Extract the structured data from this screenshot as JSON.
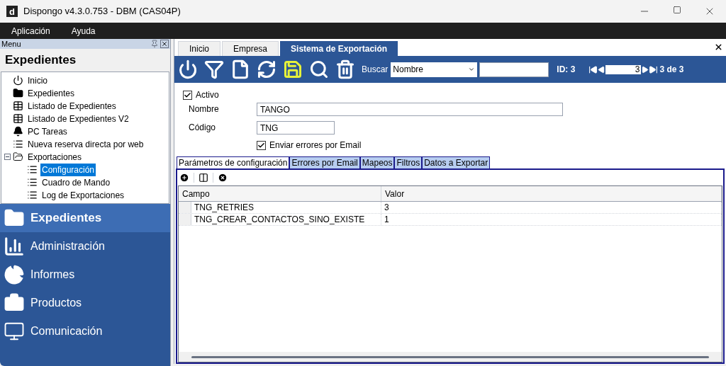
{
  "window": {
    "logo": "d",
    "title": "Dispongo v4.3.0.753 - DBM (CAS04P)"
  },
  "menu_bar": [
    "Aplicación",
    "Ayuda"
  ],
  "side_panel": {
    "header": "Menu",
    "title": "Expedientes",
    "tree": [
      {
        "label": "Inicio",
        "kind": "power",
        "selected": false
      },
      {
        "label": "Expedientes",
        "kind": "folder",
        "selected": false
      },
      {
        "label": "Listado de Expedientes",
        "kind": "table",
        "selected": false
      },
      {
        "label": "Listado de Expedientes V2",
        "kind": "table",
        "selected": false
      },
      {
        "label": "PC Tareas",
        "kind": "bell",
        "selected": false
      },
      {
        "label": "Nueva reserva directa por web",
        "kind": "list",
        "selected": false
      },
      {
        "label": "Exportaciones",
        "kind": "folder-open",
        "selected": false,
        "expanded": true,
        "children": [
          {
            "label": "Configuración",
            "kind": "list",
            "selected": true
          },
          {
            "label": "Cuadro de Mando",
            "kind": "list",
            "selected": false
          },
          {
            "label": "Log de Exportaciones",
            "kind": "list",
            "selected": false
          }
        ]
      }
    ],
    "nav": [
      {
        "label": "Expedientes",
        "kind": "folder",
        "selected": true
      },
      {
        "label": "Administración",
        "kind": "chart",
        "selected": false
      },
      {
        "label": "Informes",
        "kind": "pie",
        "selected": false
      },
      {
        "label": "Productos",
        "kind": "briefcase",
        "selected": false
      },
      {
        "label": "Comunicación",
        "kind": "monitor",
        "selected": false
      }
    ]
  },
  "doc_tabs": [
    {
      "label": "Inicio",
      "selected": false
    },
    {
      "label": "Empresa",
      "selected": false
    },
    {
      "label": "Sistema de Exportación",
      "selected": true
    }
  ],
  "toolbar": {
    "search_label": "Buscar",
    "search_field": "Nombre",
    "id": "ID: 3",
    "record": "3",
    "record_count": "3 de 3"
  },
  "form": {
    "active": {
      "label": "Activo",
      "checked": true
    },
    "fields": [
      {
        "label": "Nombre",
        "value": "TANGO"
      },
      {
        "label": "Código",
        "value": "TNG"
      }
    ],
    "send_errors": {
      "label": "Enviar errores por Email",
      "checked": true
    }
  },
  "sub_tabs": [
    {
      "label": "Parámetros de configuración",
      "selected": true
    },
    {
      "label": "Errores por Email",
      "selected": false
    },
    {
      "label": "Mapeos",
      "selected": false
    },
    {
      "label": "Filtros",
      "selected": false
    },
    {
      "label": "Datos a Exportar",
      "selected": false
    }
  ],
  "table": {
    "columns": [
      "Campo",
      "Valor"
    ],
    "rows": [
      [
        "TNG_RETRIES",
        "3"
      ],
      [
        "TNG_CREAR_CONTACTOS_SINO_EXISTE",
        "1"
      ]
    ]
  }
}
